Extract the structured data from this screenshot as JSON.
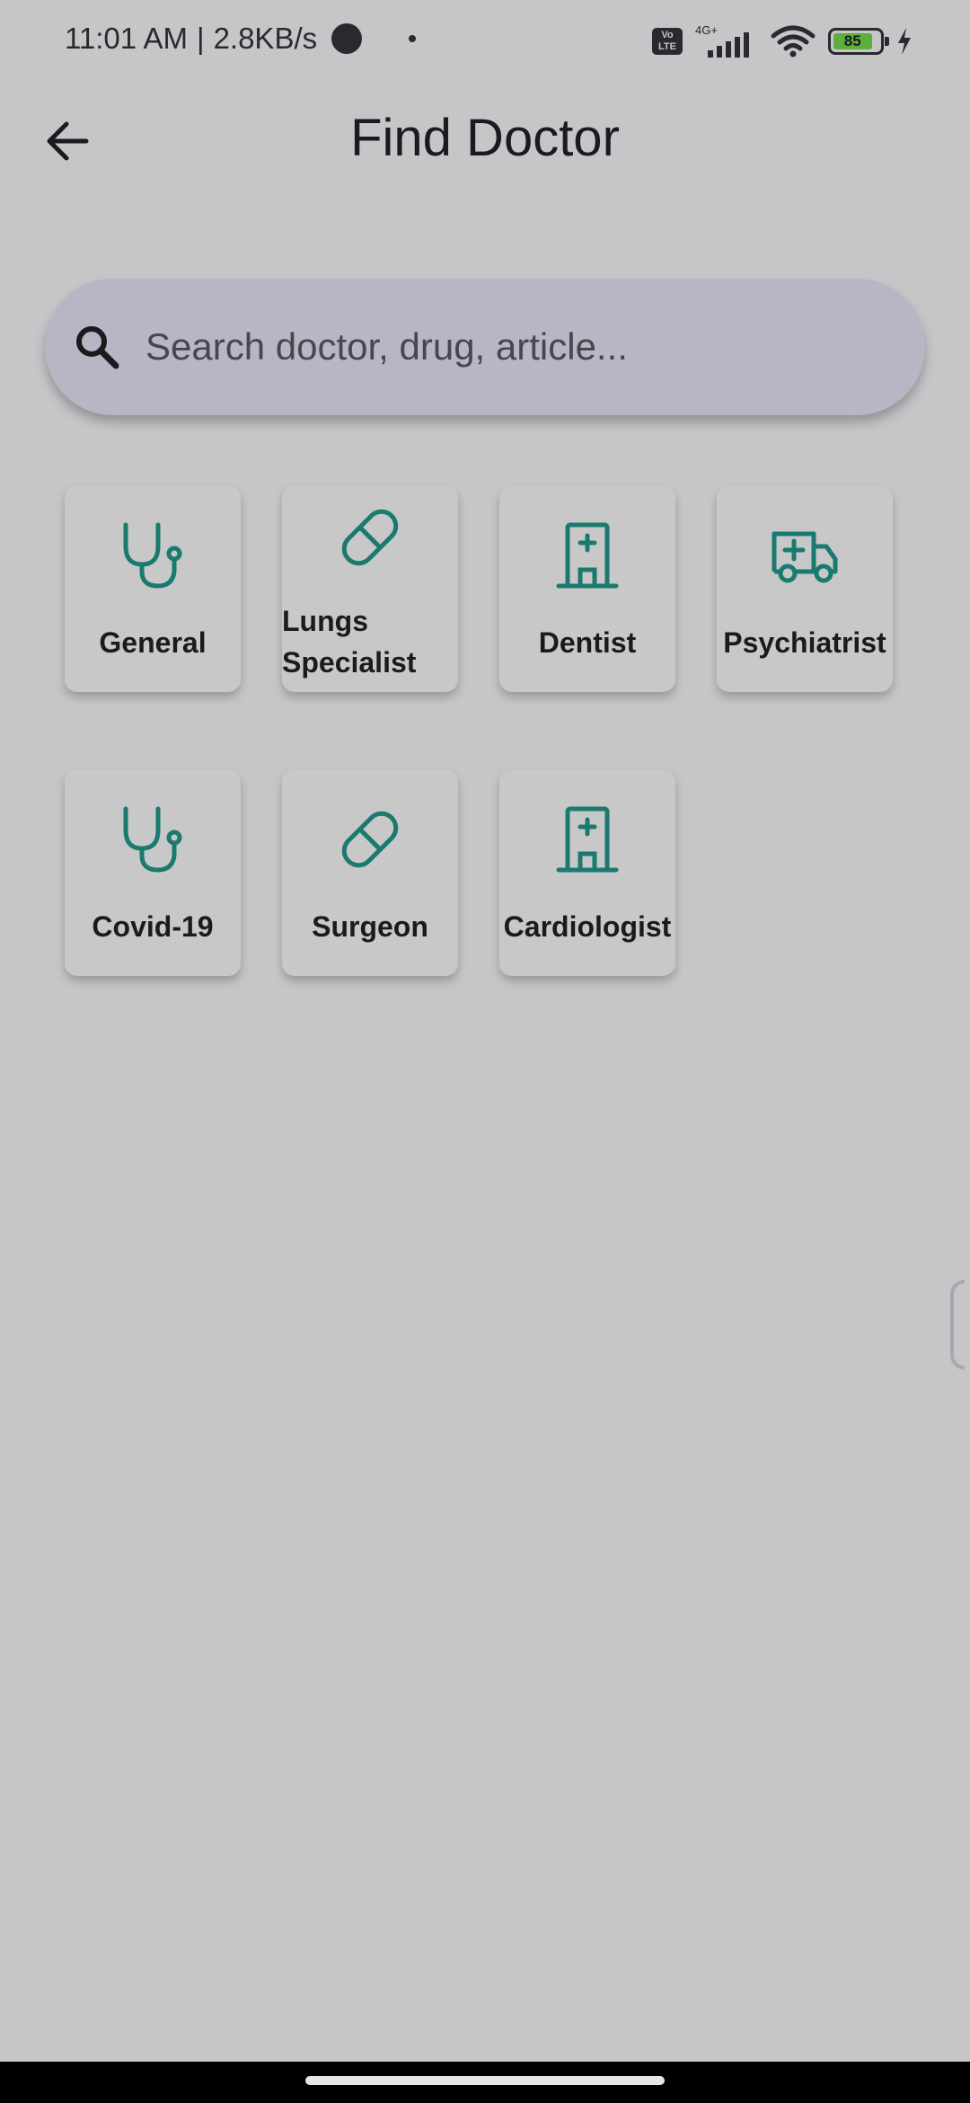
{
  "status_bar": {
    "time": "11:01 AM",
    "speed": "2.8KB/s",
    "separator": "|",
    "network_type": "4G+",
    "volte_label": "Vo LTE",
    "battery_level": "85"
  },
  "app_bar": {
    "title": "Find Doctor",
    "back_icon": "arrow-left-icon"
  },
  "search": {
    "placeholder": "Search doctor, drug, article...",
    "icon": "search-icon"
  },
  "categories": [
    {
      "label": "General",
      "icon": "stethoscope-icon"
    },
    {
      "label": "Lungs\nSpecialist",
      "icon": "pill-icon"
    },
    {
      "label": "Dentist",
      "icon": "hospital-icon"
    },
    {
      "label": "Psychiatrist",
      "icon": "ambulance-icon"
    },
    {
      "label": "Covid-19",
      "icon": "stethoscope-icon"
    },
    {
      "label": "Surgeon",
      "icon": "pill-icon"
    },
    {
      "label": "Cardiologist",
      "icon": "hospital-icon"
    }
  ],
  "colors": {
    "background": "#c6c5c8",
    "search_bg": "#bab5c5",
    "card_bg": "#c8c8c8",
    "icon_accent": "#1a7a6f",
    "text": "#1b1b1f"
  }
}
